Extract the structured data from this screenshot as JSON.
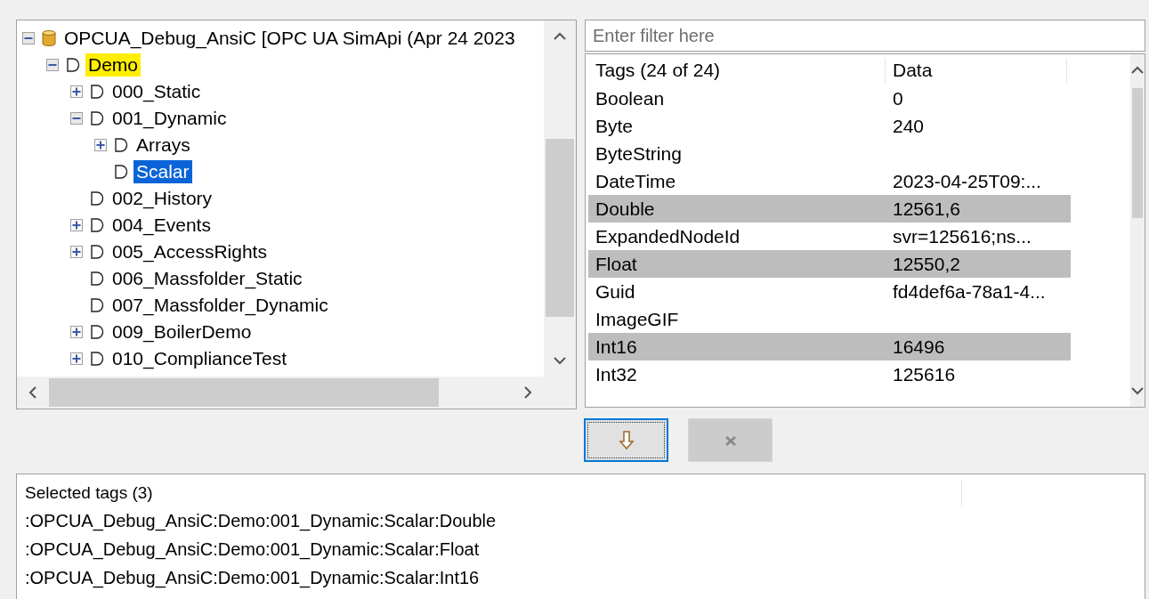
{
  "tree": {
    "nodes": [
      {
        "label": "OPCUA_Debug_AnsiC [OPC UA SimApi (Apr 24 2023",
        "kind": "database",
        "expanded": true,
        "selected": false,
        "highlighted": false,
        "children": [
          {
            "label": "Demo",
            "kind": "folder",
            "expanded": true,
            "selected": false,
            "highlighted": true,
            "children": [
              {
                "label": "000_Static",
                "kind": "folder",
                "expanded": false,
                "selected": false,
                "highlighted": false
              },
              {
                "label": "001_Dynamic",
                "kind": "folder",
                "expanded": true,
                "selected": false,
                "highlighted": false,
                "children": [
                  {
                    "label": "Arrays",
                    "kind": "folder",
                    "expanded": false,
                    "selected": false,
                    "highlighted": false
                  },
                  {
                    "label": "Scalar",
                    "kind": "leaf",
                    "selected": true,
                    "highlighted": false
                  }
                ]
              },
              {
                "label": "002_History",
                "kind": "leaf",
                "selected": false,
                "highlighted": false
              },
              {
                "label": "004_Events",
                "kind": "folder",
                "expanded": false,
                "selected": false,
                "highlighted": false
              },
              {
                "label": "005_AccessRights",
                "kind": "folder",
                "expanded": false,
                "selected": false,
                "highlighted": false
              },
              {
                "label": "006_Massfolder_Static",
                "kind": "leaf",
                "selected": false,
                "highlighted": false
              },
              {
                "label": "007_Massfolder_Dynamic",
                "kind": "leaf",
                "selected": false,
                "highlighted": false
              },
              {
                "label": "009_BoilerDemo",
                "kind": "folder",
                "expanded": false,
                "selected": false,
                "highlighted": false
              },
              {
                "label": "010_ComplianceTest",
                "kind": "folder",
                "expanded": false,
                "selected": false,
                "highlighted": false
              }
            ]
          }
        ]
      }
    ]
  },
  "filter": {
    "placeholder": "Enter filter here"
  },
  "table": {
    "columns": [
      "Tags (24 of 24)",
      "Data"
    ],
    "rows": [
      {
        "tag": "Boolean",
        "data": "0",
        "selected": false
      },
      {
        "tag": "Byte",
        "data": "240",
        "selected": false
      },
      {
        "tag": "ByteString",
        "data": "",
        "selected": false
      },
      {
        "tag": "DateTime",
        "data": "2023-04-25T09:...",
        "selected": false
      },
      {
        "tag": "Double",
        "data": "12561,6",
        "selected": true
      },
      {
        "tag": "ExpandedNodeId",
        "data": "svr=125616;ns...",
        "selected": false
      },
      {
        "tag": "Float",
        "data": "12550,2",
        "selected": true
      },
      {
        "tag": "Guid",
        "data": "fd4def6a-78a1-4...",
        "selected": false
      },
      {
        "tag": "ImageGIF",
        "data": "",
        "selected": false
      },
      {
        "tag": "Int16",
        "data": "16496",
        "selected": true
      },
      {
        "tag": "Int32",
        "data": "125616",
        "selected": false
      }
    ]
  },
  "buttons": [
    {
      "kind": "add",
      "focused": true,
      "disabled": false
    },
    {
      "kind": "remove",
      "focused": false,
      "disabled": true
    }
  ],
  "selected_tags": {
    "header": "Selected tags (3)",
    "items": [
      ":OPCUA_Debug_AnsiC:Demo:001_Dynamic:Scalar:Double",
      ":OPCUA_Debug_AnsiC:Demo:001_Dynamic:Scalar:Float",
      ":OPCUA_Debug_AnsiC:Demo:001_Dynamic:Scalar:Int16"
    ]
  }
}
